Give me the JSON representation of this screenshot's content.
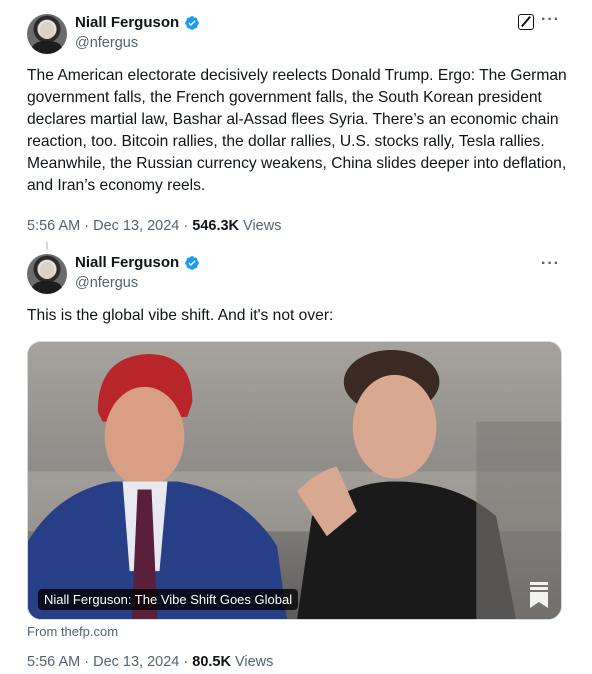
{
  "tweets": [
    {
      "author": {
        "name": "Niall Ferguson",
        "handle": "@nfergus",
        "verified_icon": "verified-badge-icon"
      },
      "text": "The American electorate decisively reelects Donald Trump. Ergo: The German government falls, the French government falls, the South Korean president declares martial law, Bashar al-Assad flees Syria. There’s an economic chain reaction, too. Bitcoin rallies, the dollar rallies, U.S. stocks rally, Tesla rallies. Meanwhile, the Russian currency weakens, China slides deeper into deflation, and Iran’s economy reels.",
      "time": "5:56 AM",
      "date": "Dec 13, 2024",
      "views_count": "546.3K",
      "views_label": "Views",
      "more_label": "···"
    },
    {
      "author": {
        "name": "Niall Ferguson",
        "handle": "@nfergus",
        "verified_icon": "verified-badge-icon"
      },
      "text": "This is the global vibe shift. And it's not over:",
      "card": {
        "caption": "Niall Ferguson: The Vibe Shift Goes Global",
        "source": "From thefp.com",
        "icon": "bookmark-icon"
      },
      "time": "5:56 AM",
      "date": "Dec 13, 2024",
      "views_count": "80.5K",
      "views_label": "Views",
      "more_label": "···"
    }
  ],
  "colors": {
    "text": "#0f1419",
    "secondary": "#536471",
    "verified": "#1d9bf0",
    "border": "#cfd9de"
  },
  "icons": {
    "grok": "grok-icon",
    "more": "more-icon"
  }
}
